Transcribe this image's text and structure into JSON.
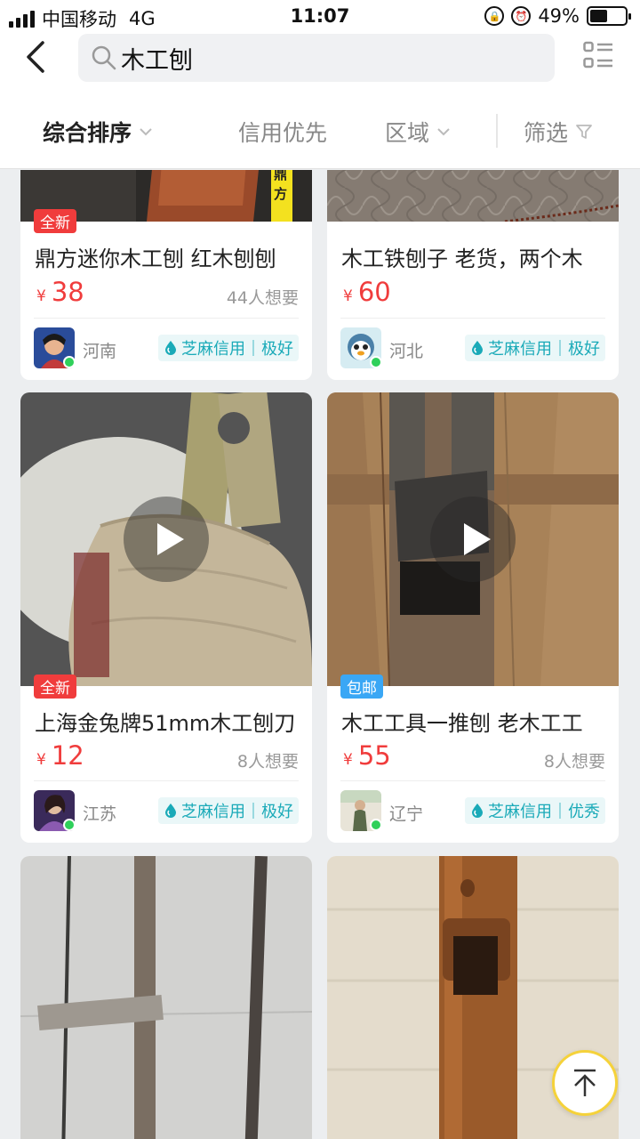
{
  "status": {
    "carrier": "中国移动",
    "network": "4G",
    "time": "11:07",
    "battery_percent": "49%",
    "battery_level": 0.49
  },
  "header": {
    "search_query": "木工刨",
    "back_icon": "chevron-left-icon",
    "layout_icon": "list-layout-icon"
  },
  "filters": {
    "sort": "综合排序",
    "credit_first": "信用优先",
    "region": "区域",
    "filter": "筛选"
  },
  "products": [
    {
      "tag": "全新",
      "tag_color": "#f03c3c",
      "title": "鼎方迷你木工刨 红木刨刨",
      "currency": "¥",
      "price": "38",
      "wants": "44人想要",
      "region": "河南",
      "credit": "芝麻信用｜极好",
      "is_video": false
    },
    {
      "tag": "",
      "title": "木工铁刨子 老货，两个木",
      "currency": "¥",
      "price": "60",
      "wants": "",
      "region": "河北",
      "credit": "芝麻信用｜极好",
      "is_video": false
    },
    {
      "tag": "全新",
      "tag_color": "#f03c3c",
      "title": "上海金兔牌51mm木工刨刀",
      "currency": "¥",
      "price": "12",
      "wants": "8人想要",
      "region": "江苏",
      "credit": "芝麻信用｜极好",
      "is_video": true
    },
    {
      "tag": "包邮",
      "tag_color": "#3aa7f5",
      "title": "木工工具一推刨 老木工工",
      "currency": "¥",
      "price": "55",
      "wants": "8人想要",
      "region": "辽宁",
      "credit": "芝麻信用｜优秀",
      "is_video": true
    }
  ],
  "colors": {
    "price_red": "#f03c3c",
    "credit_teal": "#1aaab8",
    "online_green": "#2fd05a",
    "back_to_top_border": "#f5d23a"
  },
  "back_to_top_icon": "arrow-up-icon"
}
